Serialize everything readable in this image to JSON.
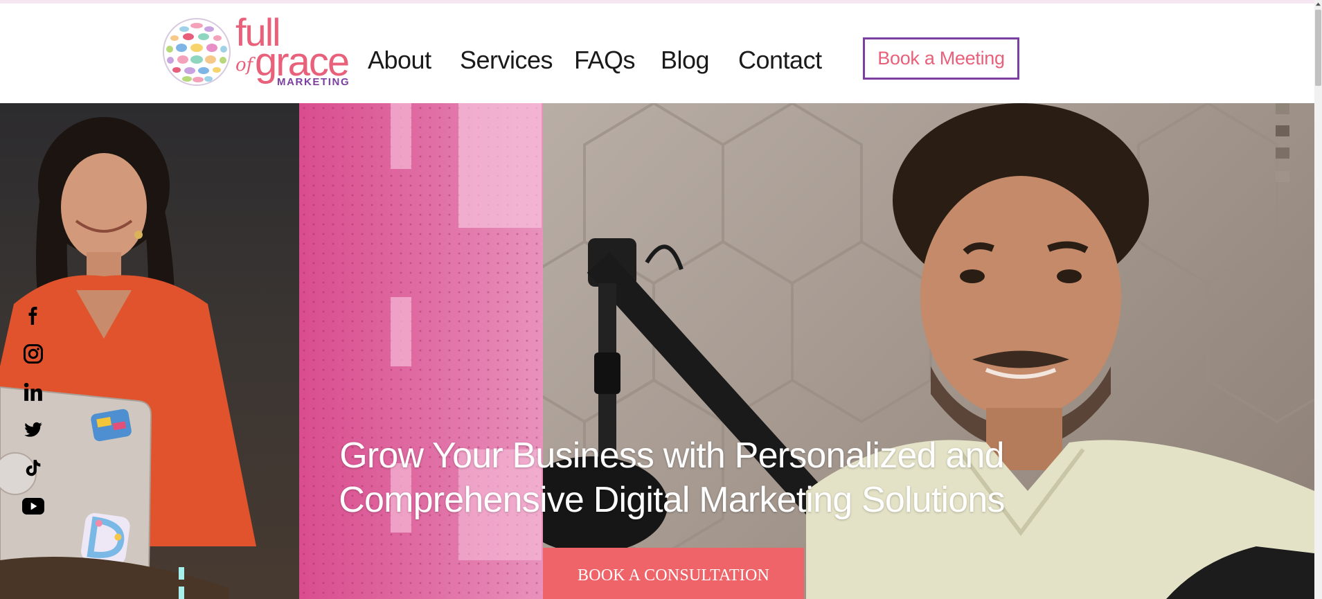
{
  "brand": {
    "logo_line1": "full",
    "logo_of": "of",
    "logo_line2": "grace",
    "logo_sub": "MARKETING",
    "primary_color": "#e8607a",
    "accent_color": "#7b3fa0"
  },
  "nav": {
    "items": [
      {
        "label": "About"
      },
      {
        "label": "Services"
      },
      {
        "label": "FAQs"
      },
      {
        "label": "Blog"
      },
      {
        "label": "Contact"
      }
    ],
    "book_button": "Book a Meeting"
  },
  "social": [
    {
      "icon": "facebook-icon"
    },
    {
      "icon": "instagram-icon"
    },
    {
      "icon": "linkedin-icon"
    },
    {
      "icon": "twitter-icon"
    },
    {
      "icon": "tiktok-icon"
    },
    {
      "icon": "youtube-icon"
    }
  ],
  "hero": {
    "title_line1": "Grow Your Business with Personalized and",
    "title_line2": "Comprehensive Digital Marketing Solutions",
    "cta_label": "BOOK A CONSULTATION",
    "cta_color": "#ee6468"
  }
}
